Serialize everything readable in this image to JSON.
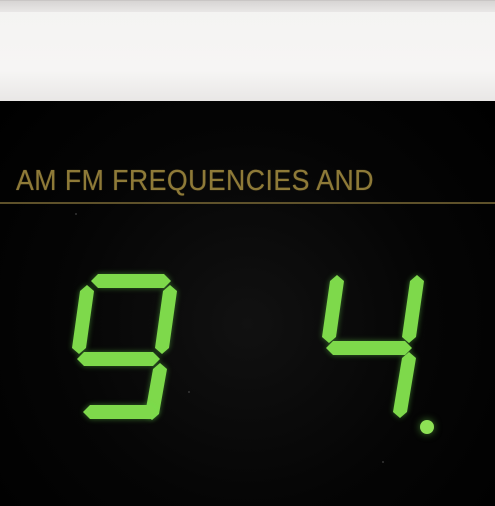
{
  "scene": {
    "label_text": "AM FM FREQUENCIES AND",
    "digits": [
      "9",
      "4"
    ],
    "decimal_point": ".",
    "digit_color": "#7ed94b",
    "label_color": "#8e7a38",
    "panel_color": "#f5f4f3",
    "display_color": "#050505"
  }
}
